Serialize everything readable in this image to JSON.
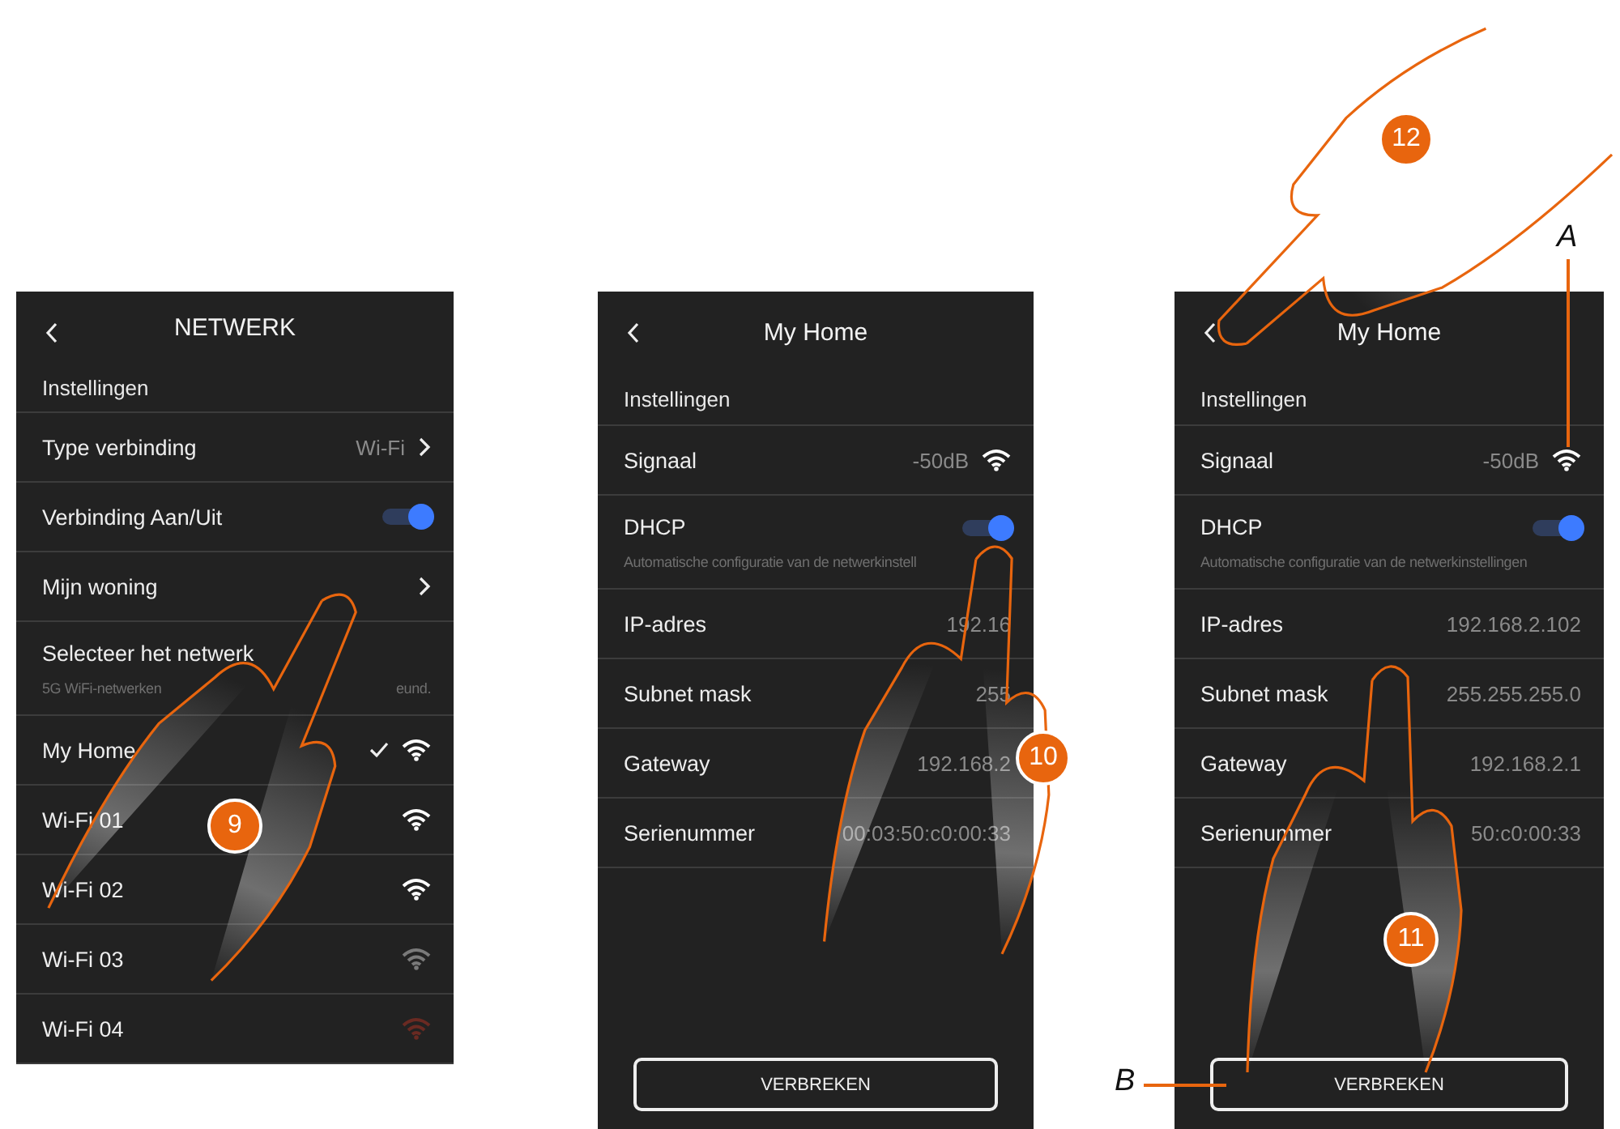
{
  "screens": [
    {
      "title": "NETWERK",
      "section": "Instellingen",
      "rows": [
        {
          "kind": "link",
          "label": "Type verbinding",
          "value": "Wi-Fi"
        },
        {
          "kind": "toggle",
          "label": "Verbinding Aan/Uit",
          "on": true
        },
        {
          "kind": "link",
          "label": "Mijn woning"
        },
        {
          "kind": "group",
          "label": "Selecteer het netwerk",
          "notes": [
            "5G WiFi-netwerken",
            "eund."
          ]
        },
        {
          "kind": "network",
          "label": "My Home",
          "checked": true,
          "color": "#ffffff"
        },
        {
          "kind": "network",
          "label": "Wi-Fi 01",
          "checked": false,
          "color": "#ffffff"
        },
        {
          "kind": "network",
          "label": "Wi-Fi 02",
          "checked": false,
          "color": "#ffffff"
        },
        {
          "kind": "network",
          "label": "Wi-Fi 03",
          "checked": false,
          "color": "#7a7a7a"
        },
        {
          "kind": "network",
          "label": "Wi-Fi 04",
          "checked": false,
          "color": "#6a2a22"
        }
      ]
    },
    {
      "title": "My Home",
      "section": "Instellingen",
      "button": "VERBREKEN",
      "rows": [
        {
          "kind": "signal",
          "label": "Signaal",
          "value": "-50dB"
        },
        {
          "kind": "toggle",
          "label": "DHCP",
          "on": true,
          "note": "Automatische configuratie van de netwerkinstell"
        },
        {
          "kind": "value",
          "label": "IP-adres",
          "value": "192.16"
        },
        {
          "kind": "value",
          "label": "Subnet mask",
          "value": "255"
        },
        {
          "kind": "value",
          "label": "Gateway",
          "value": "192.168.2"
        },
        {
          "kind": "value",
          "label": "Serienummer",
          "value": "00:03:50:c0:00:33"
        }
      ]
    },
    {
      "title": "My Home",
      "section": "Instellingen",
      "button": "VERBREKEN",
      "rows": [
        {
          "kind": "signal",
          "label": "Signaal",
          "value": "-50dB"
        },
        {
          "kind": "toggle",
          "label": "DHCP",
          "on": true,
          "note": "Automatische configuratie van de netwerkinstellingen"
        },
        {
          "kind": "value",
          "label": "IP-adres",
          "value": "192.168.2.102"
        },
        {
          "kind": "value",
          "label": "Subnet mask",
          "value": "255.255.255.0"
        },
        {
          "kind": "value",
          "label": "Gateway",
          "value": "192.168.2.1"
        },
        {
          "kind": "value",
          "label": "Serienummer",
          "value": "50:c0:00:33"
        }
      ]
    }
  ],
  "steps": [
    "9",
    "10",
    "11",
    "12"
  ],
  "callouts": [
    "A",
    "B"
  ]
}
